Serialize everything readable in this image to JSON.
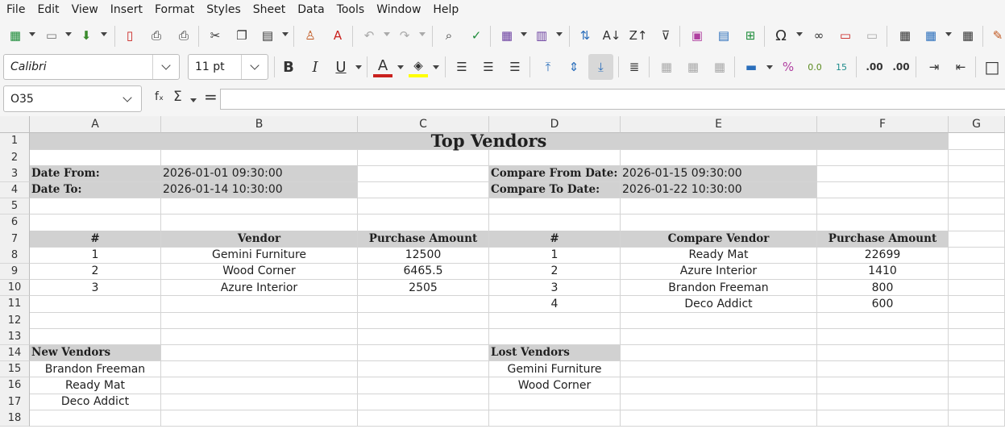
{
  "menu": [
    "File",
    "Edit",
    "View",
    "Insert",
    "Format",
    "Styles",
    "Sheet",
    "Data",
    "Tools",
    "Window",
    "Help"
  ],
  "font_name": "Calibri",
  "font_size": "11 pt",
  "cell_ref": "O35",
  "formula_value": "",
  "columns": [
    "A",
    "B",
    "C",
    "D",
    "E",
    "F",
    "G"
  ],
  "rows": [
    "1",
    "2",
    "3",
    "4",
    "5",
    "6",
    "7",
    "8",
    "9",
    "10",
    "11",
    "12",
    "13",
    "14",
    "15",
    "16",
    "17",
    "18"
  ],
  "sheet": {
    "title": "Top Vendors",
    "date_from_label": "Date From:",
    "date_from": "2026-01-01 09:30:00",
    "date_to_label": "Date To:",
    "date_to": "2026-01-14 10:30:00",
    "compare_from_label": "Compare From Date:",
    "compare_from": "2026-01-15 09:30:00",
    "compare_to_label": "Compare To Date:",
    "compare_to": "2026-01-22 10:30:00",
    "left_headers": [
      "#",
      "Vendor",
      "Purchase Amount"
    ],
    "right_headers": [
      "#",
      "Compare Vendor",
      "Purchase Amount"
    ],
    "left_rows": [
      [
        "1",
        "Gemini Furniture",
        "12500"
      ],
      [
        "2",
        "Wood Corner",
        "6465.5"
      ],
      [
        "3",
        "Azure Interior",
        "2505"
      ]
    ],
    "right_rows": [
      [
        "1",
        "Ready Mat",
        "22699"
      ],
      [
        "2",
        "Azure Interior",
        "1410"
      ],
      [
        "3",
        "Brandon Freeman",
        "800"
      ],
      [
        "4",
        "Deco Addict",
        "600"
      ]
    ],
    "new_vendors_label": "New Vendors",
    "new_vendors": [
      "Brandon Freeman",
      "Ready Mat",
      "Deco Addict"
    ],
    "lost_vendors_label": "Lost Vendors",
    "lost_vendors": [
      "Gemini Furniture",
      "Wood Corner"
    ]
  },
  "colors": {
    "header_fill": "#d1d1d1",
    "font_color_bar": "#c9211e",
    "highlight_bar": "#ffff00"
  }
}
